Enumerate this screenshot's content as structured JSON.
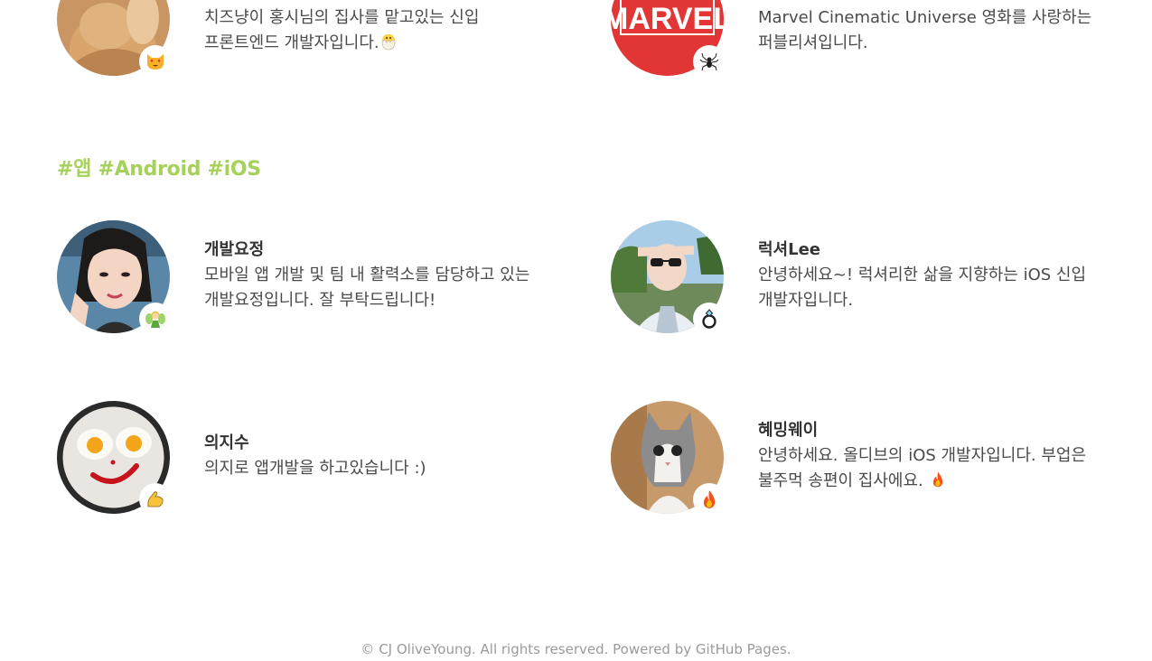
{
  "colors": {
    "accent": "#a6d15a",
    "text": "#333333",
    "muted": "#9b9b9b"
  },
  "top_members": [
    {
      "avatar": "cheese-cat-photo",
      "badge_icon": "heart-eyes-cat-icon",
      "description": "치즈냥이 홍시님의 집사를 맡고있는 신입 프론트엔드 개발자입니다.",
      "trailing_icon": "hatching-chick-icon"
    },
    {
      "avatar": "marvel-logo",
      "logo_text": "MARVEL",
      "badge_icon": "spider-icon",
      "description": "Marvel Cinematic Universe 영화를 사랑하는 퍼블리셔입니다."
    }
  ],
  "section": {
    "title": "#앱 #Android #iOS"
  },
  "members": [
    {
      "name": "개발요정",
      "description": "모바일 앱 개발 및 팀 내 활력소를 담당하고 있는 개발요정입니다. 잘 부탁드립니다!",
      "avatar": "woman-selfie-photo",
      "badge_icon": "fairy-icon"
    },
    {
      "name": "럭셔Lee",
      "description": "안녕하세요~! 럭셔리한 삶을 지향하는 iOS 신입 개발자입니다.",
      "avatar": "sunglasses-man-photo",
      "badge_icon": "ring-icon"
    },
    {
      "name": "의지수",
      "description": "의지로 앱개발을 하고있습니다 :)",
      "avatar": "egg-smiley-photo",
      "badge_icon": "flexed-biceps-icon"
    },
    {
      "name": "혜밍웨이",
      "description": "안녕하세요. 올디브의 iOS 개발자입니다. 부업은 불주먹 송편이 집사에요.",
      "avatar": "gray-cat-photo",
      "badge_icon": "fire-icon",
      "trailing_icon": "fire-icon"
    }
  ],
  "footer": {
    "copyright": "© CJ OliveYoung. All rights reserved.",
    "powered_by": "Powered by",
    "github_pages": "GitHub Pages."
  }
}
